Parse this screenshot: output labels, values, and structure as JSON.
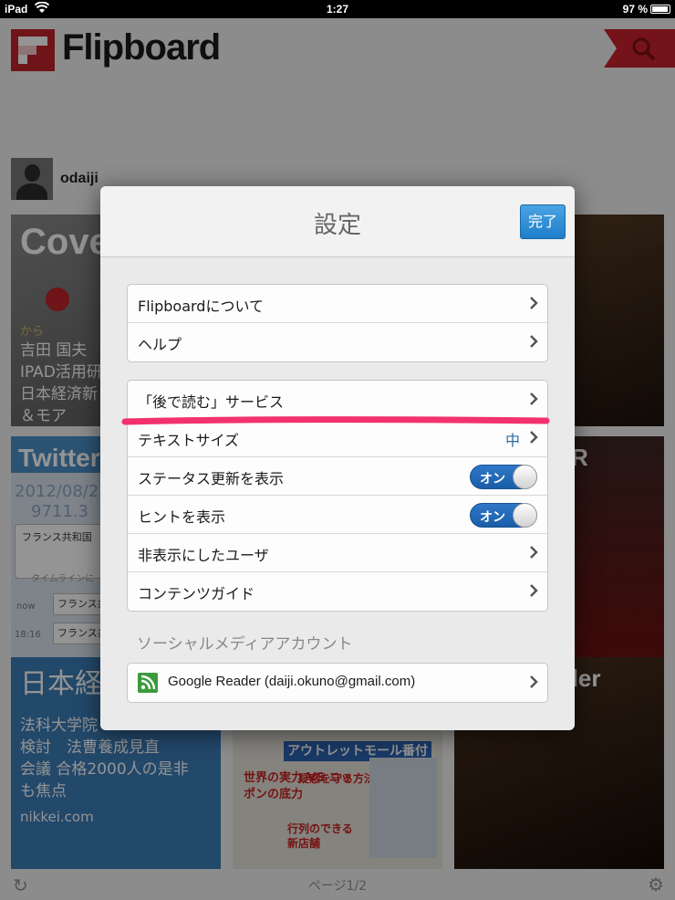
{
  "status_bar": {
    "carrier": "iPad",
    "time": "1:27",
    "battery": "97 %"
  },
  "app": {
    "logo": "Flipboard",
    "username": "odaiji",
    "tiles": [
      {
        "title": "Cover",
        "lines": [
          "から",
          "吉田 国夫",
          "IPAD活用研",
          "日本経済新",
          "＆モア"
        ]
      },
      {
        "title": "Twitter",
        "lines": [
          "2012/08/2",
          "9711.3",
          "フランス共和国",
          "タイムラインに",
          "now",
          "フランス共",
          "18:16",
          "フランス共"
        ]
      },
      {
        "title": "日本経",
        "lines": [
          "法科大学院",
          "検討　法曹養成見直",
          "会議 合格2000人の是非",
          "も焦点",
          "nikkei.com"
        ]
      },
      {
        "title": "R"
      },
      {
        "title": "der"
      },
      {
        "title": "アウトレットモール番付",
        "lines": [
          "世界の実力 VS ニッポンの底力",
          "疑惑を守る方法",
          "行列のできる新店舗"
        ]
      }
    ],
    "page_indicator": "ページ1/2"
  },
  "settings": {
    "title": "設定",
    "done_label": "完了",
    "groups": [
      [
        {
          "label": "Flipboardについて",
          "type": "disclosure"
        },
        {
          "label": "ヘルプ",
          "type": "disclosure"
        }
      ],
      [
        {
          "label": "「後で読む」サービス",
          "type": "disclosure"
        },
        {
          "label": "テキストサイズ",
          "type": "disclosure",
          "value": "中"
        },
        {
          "label": "ステータス更新を表示",
          "type": "toggle",
          "value": "オン"
        },
        {
          "label": "ヒントを表示",
          "type": "toggle",
          "value": "オン"
        },
        {
          "label": "非表示にしたユーザ",
          "type": "disclosure"
        },
        {
          "label": "コンテンツガイド",
          "type": "disclosure"
        }
      ]
    ],
    "social_section_header": "ソーシャルメディアアカウント",
    "social_accounts": [
      {
        "label": "Google Reader (daiji.okuno@gmail.com)",
        "icon": "rss-icon"
      }
    ]
  },
  "colors": {
    "accent": "#1f7fc9",
    "brand": "#c0232c",
    "highlight": "#f2316e"
  }
}
